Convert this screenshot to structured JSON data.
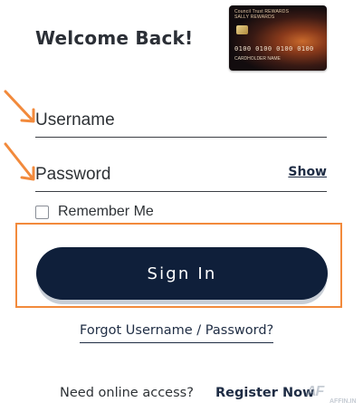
{
  "header": {
    "title": "Welcome Back!"
  },
  "card": {
    "brand_line1": "Council Trust REWARDS",
    "brand_line2": "SALLY REWARDS",
    "number": "0100 0100 0100 0100",
    "holder": "CARDHOLDER NAME"
  },
  "form": {
    "username_placeholder": "Username",
    "password_placeholder": "Password",
    "show_label": "Show",
    "remember_label": "Remember Me",
    "sign_in_label": "Sign In",
    "forgot_label": "Forgot Username / Password?"
  },
  "footer": {
    "online_access_text": "Need online access?",
    "register_label": "Register Now"
  },
  "watermark": {
    "logo": "AF",
    "text": "AFFIN.IN"
  },
  "colors": {
    "primary_button": "#0f1f3a",
    "highlight": "#f28a3c",
    "arrow": "#f28a3c"
  }
}
